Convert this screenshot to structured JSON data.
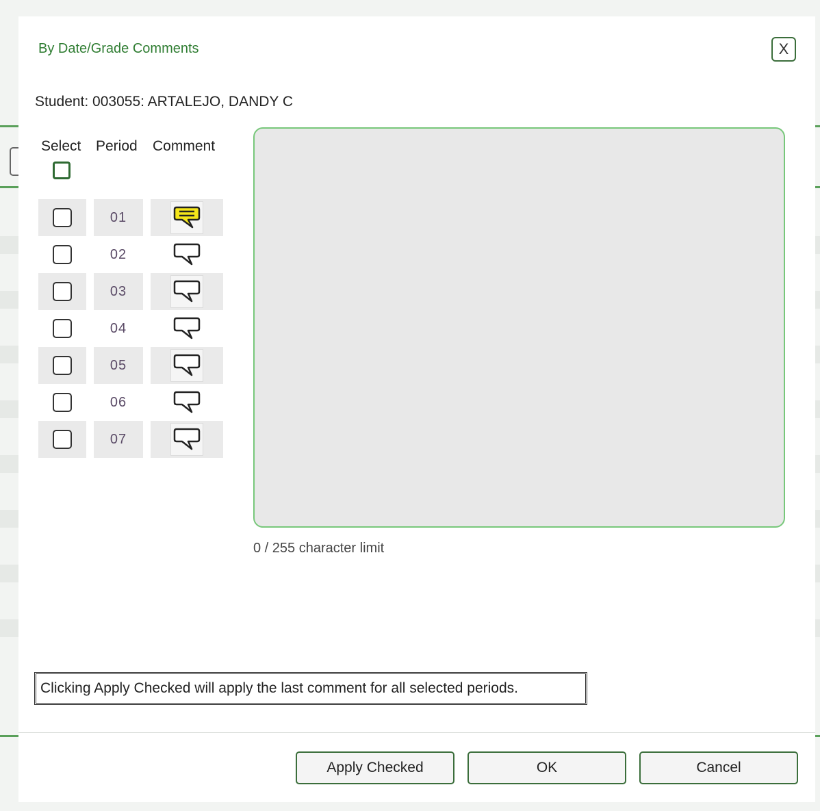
{
  "dialog": {
    "title": "By Date/Grade Comments",
    "close_label": "X",
    "student_line": "Student: 003055: ARTALEJO, DANDY C"
  },
  "table": {
    "headers": {
      "select": "Select",
      "period": "Period",
      "comment": "Comment"
    },
    "rows": [
      {
        "period": "01",
        "checked": false,
        "has_comment": true
      },
      {
        "period": "02",
        "checked": false,
        "has_comment": false
      },
      {
        "period": "03",
        "checked": false,
        "has_comment": false
      },
      {
        "period": "04",
        "checked": false,
        "has_comment": false
      },
      {
        "period": "05",
        "checked": false,
        "has_comment": false
      },
      {
        "period": "06",
        "checked": false,
        "has_comment": false
      },
      {
        "period": "07",
        "checked": false,
        "has_comment": false
      }
    ]
  },
  "comment": {
    "value": "",
    "char_limit_text": "0 / 255 character limit"
  },
  "note": "Clicking Apply Checked will apply the last comment for all selected periods.",
  "buttons": {
    "apply_checked": "Apply Checked",
    "ok": "OK",
    "cancel": "Cancel"
  },
  "colors": {
    "accent_green": "#2f7d32",
    "comment_filled": "#f5e61a",
    "textarea_border": "#77c77a"
  },
  "icons": {
    "comment_filled": "speech-bubble-filled-icon",
    "comment_empty": "speech-bubble-empty-icon"
  }
}
